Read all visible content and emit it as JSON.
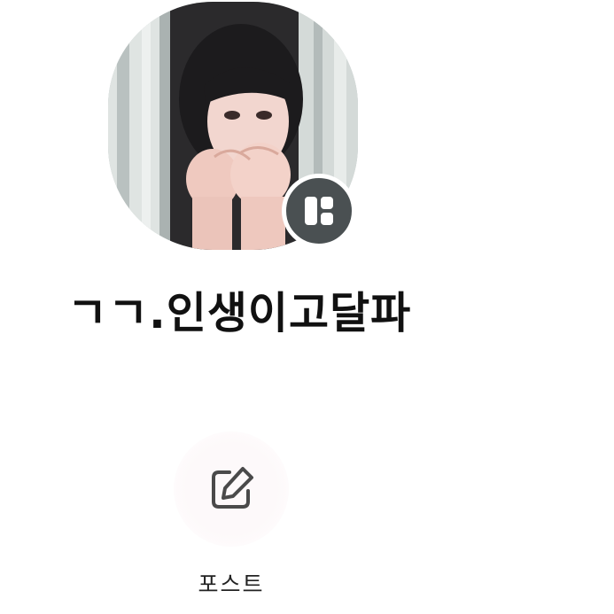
{
  "profile": {
    "name": "ㄱㄱ.인생이고달파",
    "avatar_icon": "profile-photo",
    "badge_icon": "layout-grid-icon"
  },
  "actions": {
    "post": {
      "label": "포스트",
      "icon": "edit-pencil-icon"
    }
  },
  "colors": {
    "badge_bg": "#4a5052",
    "text_primary": "#111111",
    "icon_stroke": "#4a4a4a"
  }
}
